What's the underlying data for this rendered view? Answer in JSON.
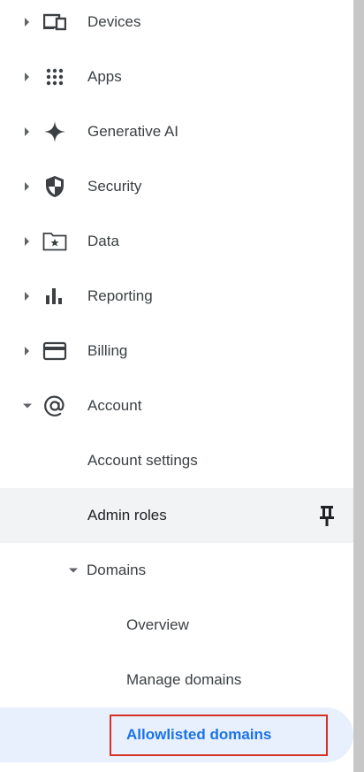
{
  "nav": {
    "items": [
      {
        "label": "Devices",
        "icon": "devices-icon"
      },
      {
        "label": "Apps",
        "icon": "apps-grid-icon"
      },
      {
        "label": "Generative AI",
        "icon": "sparkle-icon"
      },
      {
        "label": "Security",
        "icon": "shield-icon"
      },
      {
        "label": "Data",
        "icon": "folder-star-icon"
      },
      {
        "label": "Reporting",
        "icon": "bar-chart-icon"
      },
      {
        "label": "Billing",
        "icon": "credit-card-icon"
      },
      {
        "label": "Account",
        "icon": "at-sign-icon"
      }
    ],
    "account_children": {
      "account_settings": "Account settings",
      "admin_roles": "Admin roles",
      "domains": "Domains",
      "domains_children": {
        "overview": "Overview",
        "manage_domains": "Manage domains",
        "allowlisted_domains": "Allowlisted domains"
      }
    }
  },
  "colors": {
    "text": "#3c4043",
    "icon": "#5f6368",
    "selected_text": "#1a73e8",
    "selected_bg": "#e8f0fe",
    "hover_bg": "#f1f3f4",
    "highlight_border": "#d93025"
  }
}
